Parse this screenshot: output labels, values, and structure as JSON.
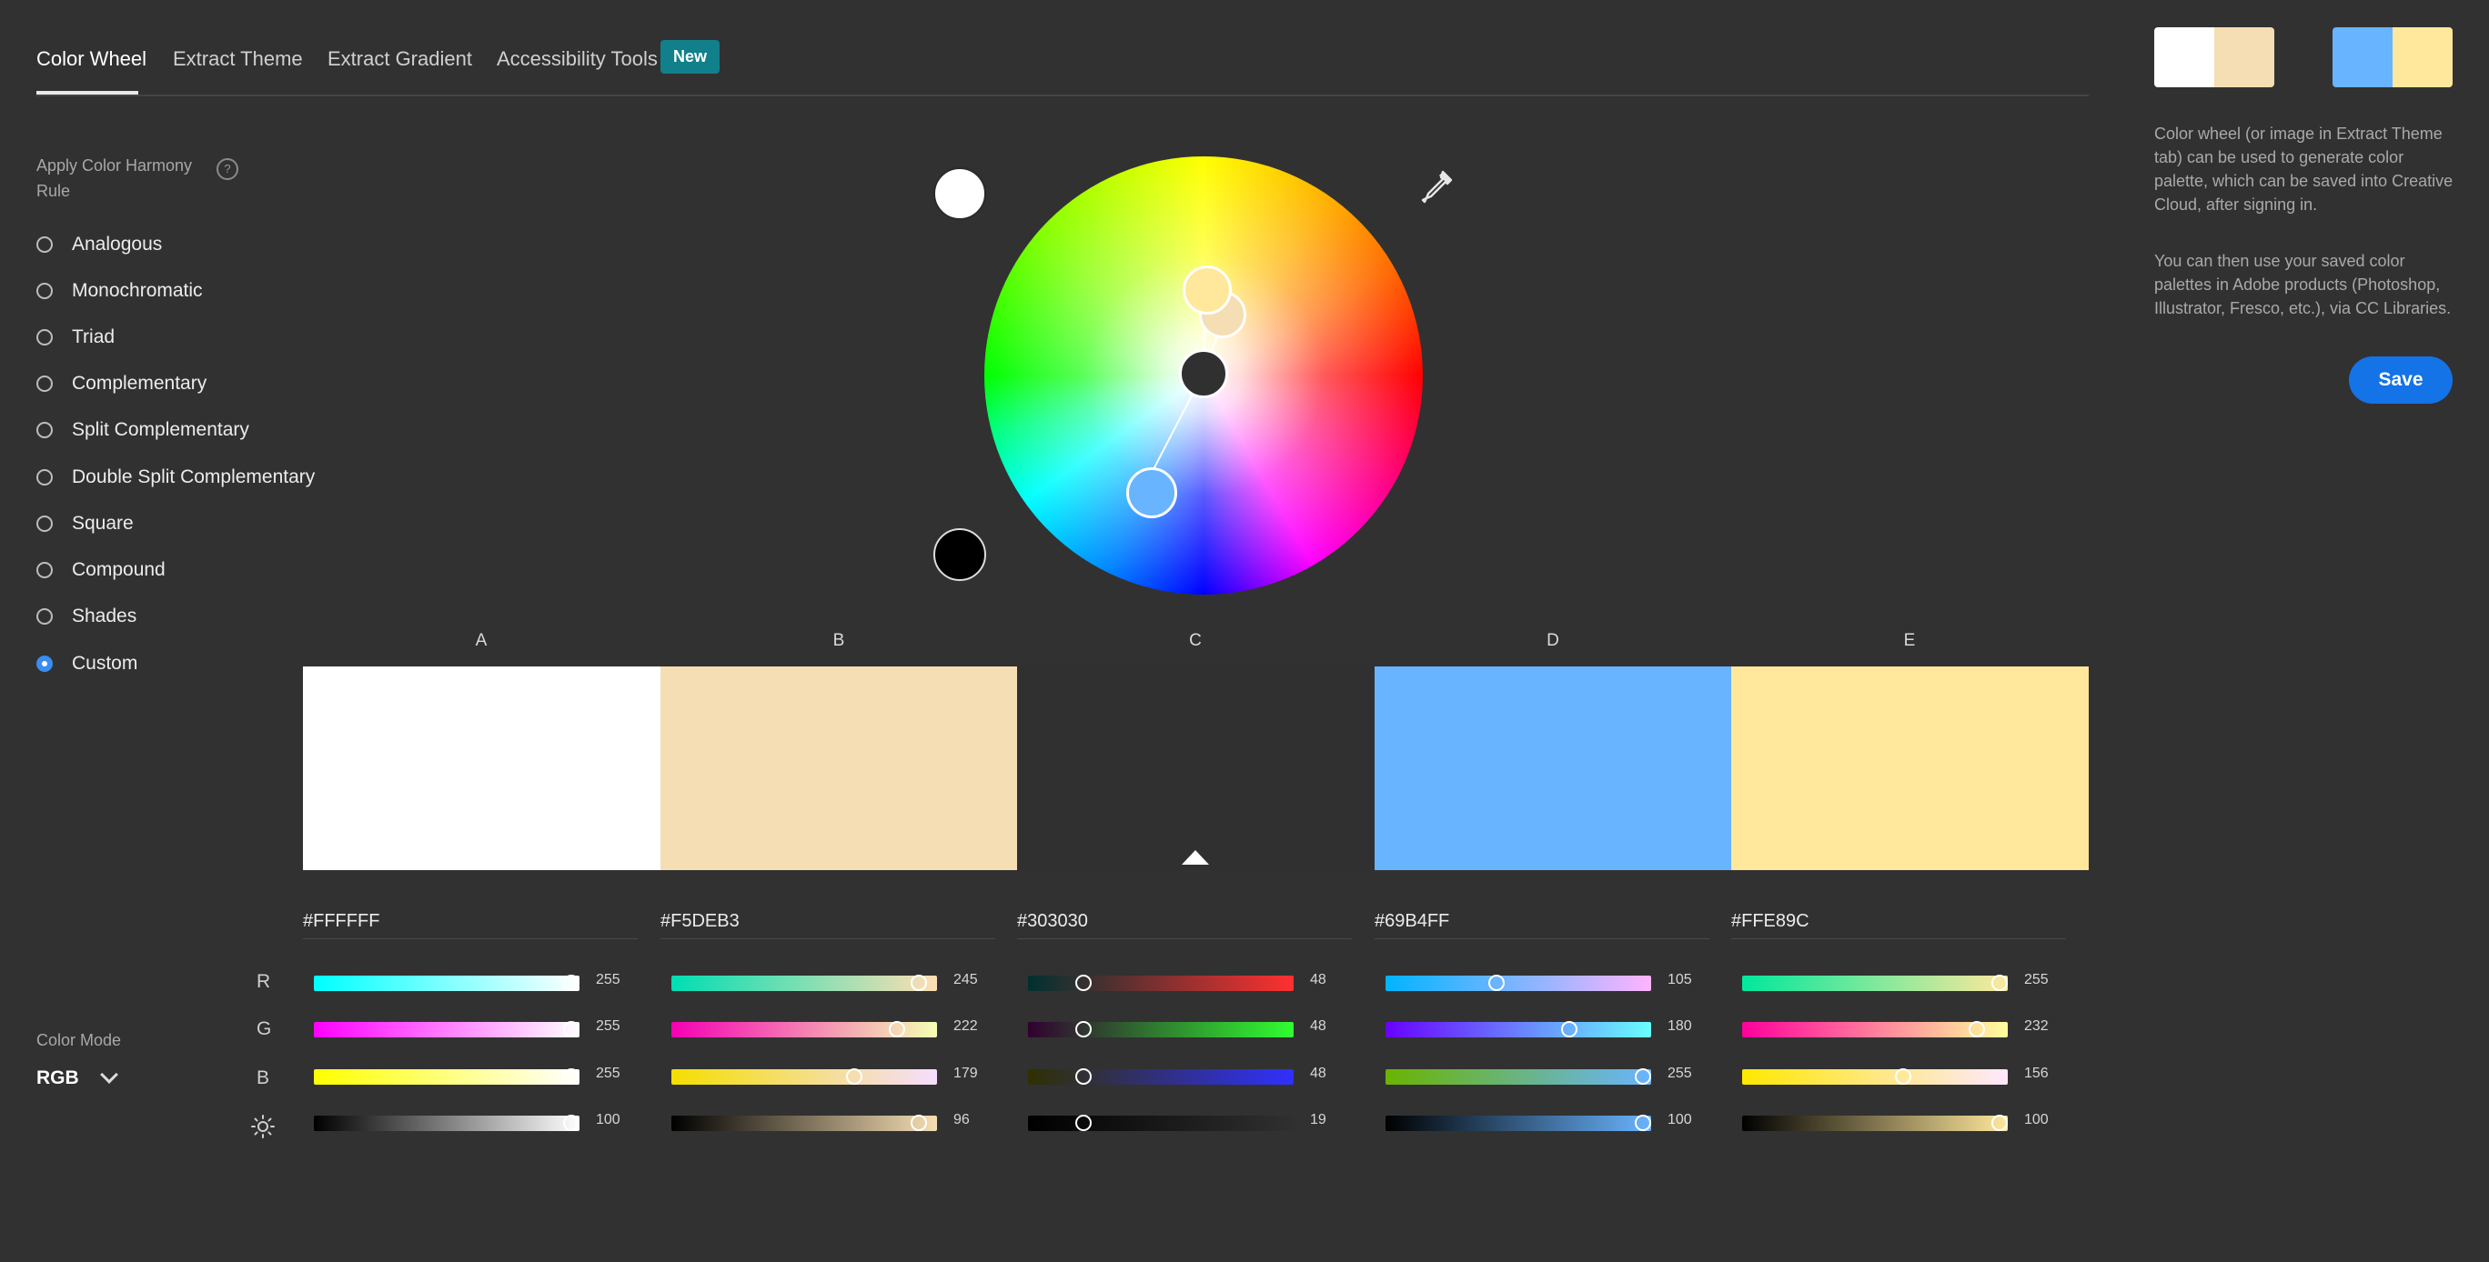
{
  "tabs": {
    "color_wheel": "Color Wheel",
    "extract_theme": "Extract Theme",
    "extract_gradient": "Extract Gradient",
    "accessibility_tools": "Accessibility Tools",
    "new_badge": "New"
  },
  "harmony": {
    "title": "Apply Color Harmony Rule",
    "help_icon": "question-mark",
    "rules": [
      "Analogous",
      "Monochromatic",
      "Triad",
      "Complementary",
      "Split Complementary",
      "Double Split Complementary",
      "Square",
      "Compound",
      "Shades",
      "Custom"
    ],
    "selected": "Custom"
  },
  "color_mode": {
    "label": "Color Mode",
    "value": "RGB"
  },
  "channels": {
    "r": "R",
    "g": "G",
    "b": "B",
    "brightness_icon": "sun"
  },
  "swatches": [
    {
      "letter": "A",
      "hex": "#FFFFFF",
      "color": "#FFFFFF",
      "r": "255",
      "g": "255",
      "b": "255",
      "brightness": "100"
    },
    {
      "letter": "B",
      "hex": "#F5DEB3",
      "color": "#F5DEB3",
      "r": "245",
      "g": "222",
      "b": "179",
      "brightness": "96"
    },
    {
      "letter": "C",
      "hex": "#303030",
      "color": "#303030",
      "r": "48",
      "g": "48",
      "b": "48",
      "brightness": "19"
    },
    {
      "letter": "D",
      "hex": "#69B4FF",
      "color": "#69B4FF",
      "r": "105",
      "g": "180",
      "b": "255",
      "brightness": "100"
    },
    {
      "letter": "E",
      "hex": "#FFE89C",
      "color": "#FFE89C",
      "r": "255",
      "g": "232",
      "b": "156",
      "brightness": "100"
    }
  ],
  "right_panel": {
    "info_1": "Color wheel (or image in Extract Theme tab) can be used to generate color palette, which can be saved into Creative Cloud, after signing in.",
    "info_2": "You can then use your saved color palettes in Adobe products (Photoshop, Illustrator, Fresco, etc.), via CC Libraries.",
    "save_label": "Save"
  },
  "icons": {
    "eyedropper": "eyedropper-icon",
    "chevron": "chevron-down-icon"
  }
}
